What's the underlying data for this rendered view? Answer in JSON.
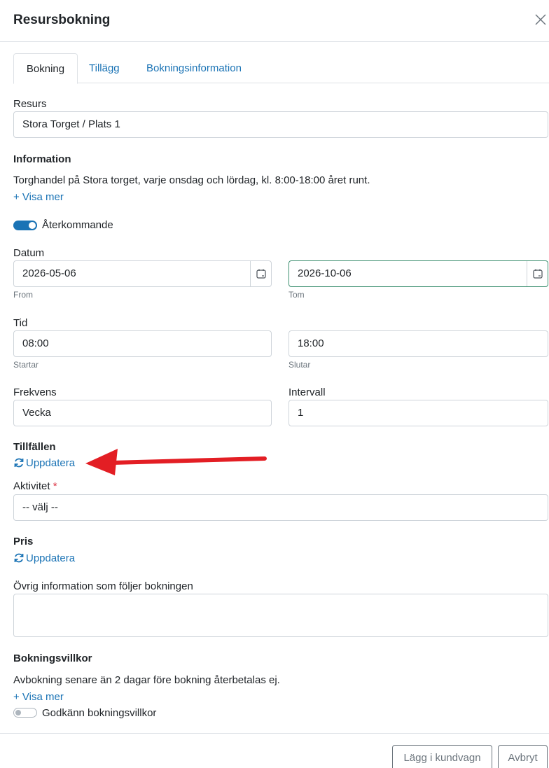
{
  "dialog": {
    "title": "Resursbokning"
  },
  "tabs": [
    {
      "label": "Bokning"
    },
    {
      "label": "Tillägg"
    },
    {
      "label": "Bokningsinformation"
    }
  ],
  "resource": {
    "label": "Resurs",
    "value": "Stora Torget / Plats 1"
  },
  "information": {
    "heading": "Information",
    "text": "Torghandel på Stora torget, varje onsdag och lördag, kl. 8:00-18:00 året runt.",
    "more_link": "+ Visa mer"
  },
  "recurring": {
    "label": "Återkommande",
    "checked": true
  },
  "date": {
    "label": "Datum",
    "from_value": "2026-05-06",
    "from_hint": "From",
    "to_value": "2026-10-06",
    "to_hint": "Tom"
  },
  "time": {
    "label": "Tid",
    "start_value": "08:00",
    "start_hint": "Startar",
    "end_value": "18:00",
    "end_hint": "Slutar"
  },
  "frequency": {
    "label": "Frekvens",
    "value": "Vecka"
  },
  "interval": {
    "label": "Intervall",
    "value": "1"
  },
  "occasions": {
    "heading": "Tillfällen",
    "refresh_label": "Uppdatera"
  },
  "activity": {
    "label": "Aktivitet",
    "required_mark": "*",
    "value": "-- välj --"
  },
  "price": {
    "heading": "Pris",
    "refresh_label": "Uppdatera"
  },
  "other_info": {
    "label": "Övrig information som följer bokningen",
    "value": ""
  },
  "terms": {
    "heading": "Bokningsvillkor",
    "text": "Avbokning senare än 2 dagar före bokning återbetalas ej.",
    "more_link": "+ Visa mer",
    "accept_label": "Godkänn bokningsvillkor",
    "accepted": false
  },
  "footer": {
    "add_to_cart_label": "Lägg i kundvagn",
    "cancel_label": "Avbryt"
  },
  "colors": {
    "accent": "#1a73b5",
    "annotation_arrow": "#e31e24",
    "focus_border": "#3c8f6f"
  },
  "icons": {
    "close": "close-icon",
    "calendar": "calendar-icon",
    "refresh": "refresh-icon"
  }
}
